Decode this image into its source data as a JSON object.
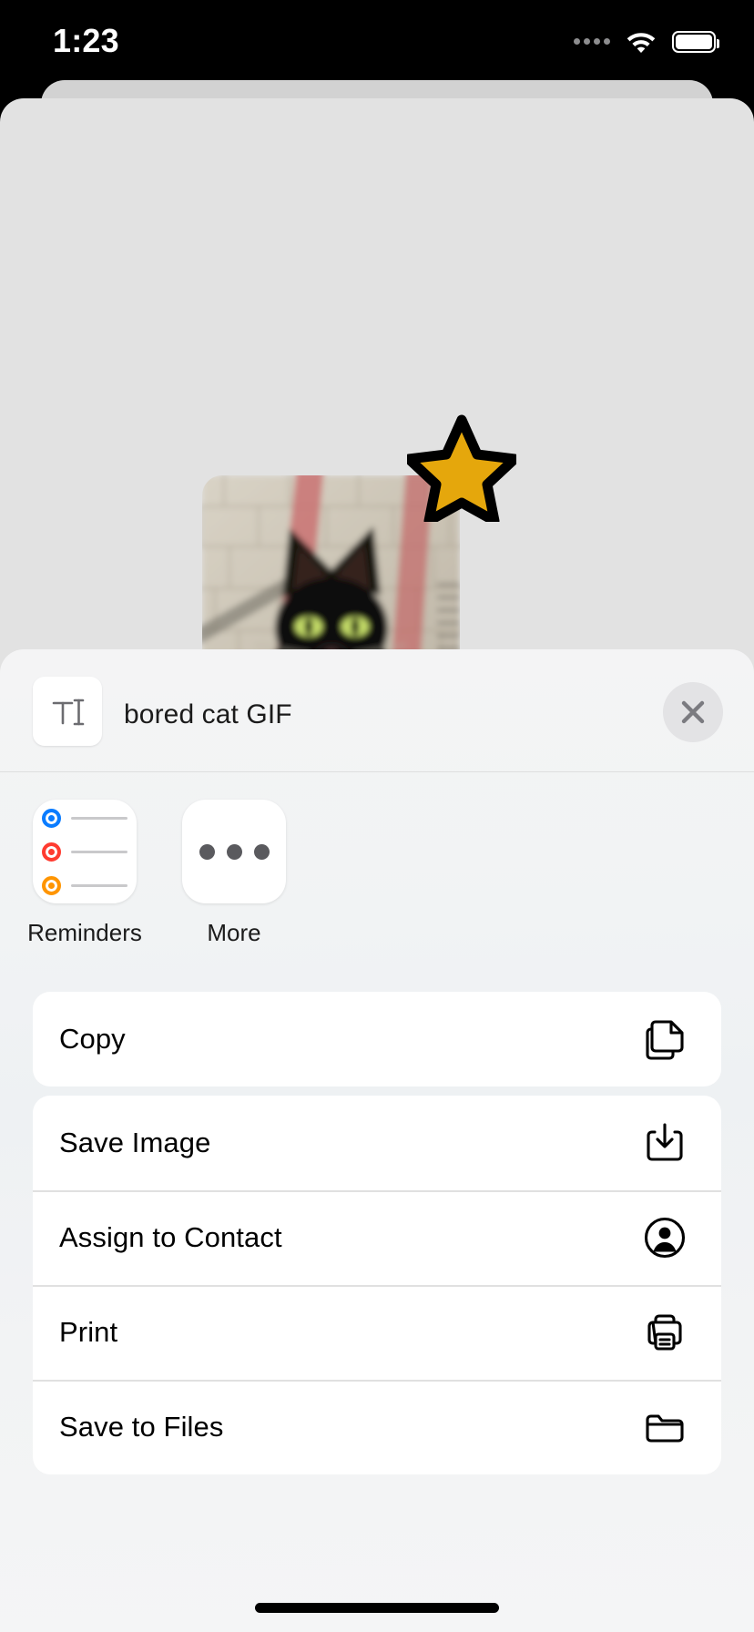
{
  "status_bar": {
    "time": "1:23",
    "signal_icon": "signal-dots-icon",
    "wifi_icon": "wifi-icon",
    "battery_icon": "battery-full-icon"
  },
  "content_preview": {
    "photo_alt": "black cat in front of brick wall",
    "sticker_icon": "gold-star-sticker",
    "sticker_color": "#E5A70C",
    "sticker_outline_color": "#000000"
  },
  "share_sheet": {
    "header": {
      "doc_icon": "text-document-icon",
      "title": "bored cat GIF",
      "close_icon": "close-x-icon"
    },
    "apps": [
      {
        "label": "Reminders",
        "icon": "reminders-app-icon",
        "dot_colors": [
          "#0A7CFF",
          "#FF3B30",
          "#FF9500"
        ]
      },
      {
        "label": "More",
        "icon": "more-ellipsis-icon"
      }
    ],
    "action_groups": [
      {
        "rows": [
          {
            "label": "Copy",
            "icon": "copy-documents-icon"
          }
        ]
      },
      {
        "rows": [
          {
            "label": "Save Image",
            "icon": "download-tray-icon"
          },
          {
            "label": "Assign to Contact",
            "icon": "person-circle-icon"
          },
          {
            "label": "Print",
            "icon": "printer-icon"
          },
          {
            "label": "Save to Files",
            "icon": "folder-icon"
          }
        ]
      }
    ]
  },
  "home_indicator": "home-indicator-bar",
  "colors": {
    "sheet_background": "#F2F3F4",
    "row_background": "#FFFFFF",
    "screen_background": "#000000",
    "card_background": "#E2E2E2"
  }
}
